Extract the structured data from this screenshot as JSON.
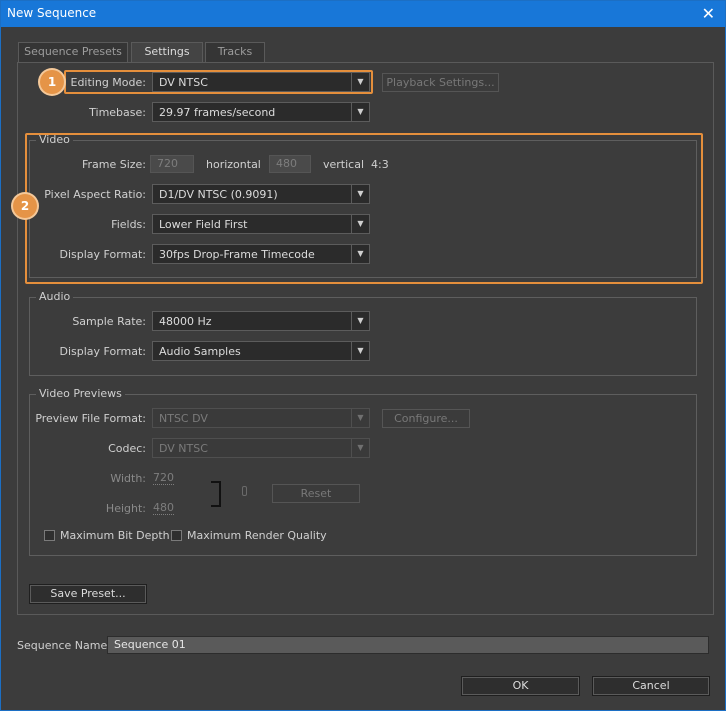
{
  "window": {
    "title": "New Sequence",
    "close_glyph": "✕"
  },
  "tabs": [
    {
      "label": "Sequence Presets"
    },
    {
      "label": "Settings"
    },
    {
      "label": "Tracks"
    }
  ],
  "settings": {
    "editing_mode": {
      "label": "Editing Mode:",
      "value": "DV NTSC"
    },
    "playback_settings": "Playback Settings...",
    "timebase": {
      "label": "Timebase:",
      "value": "29.97 frames/second"
    }
  },
  "video": {
    "title": "Video",
    "frame_size": {
      "label": "Frame Size:",
      "width": "720",
      "horizontal": "horizontal",
      "height": "480",
      "vertical": "vertical",
      "ratio": "4:3"
    },
    "pixel_aspect_ratio": {
      "label": "Pixel Aspect Ratio:",
      "value": "D1/DV NTSC (0.9091)"
    },
    "fields": {
      "label": "Fields:",
      "value": "Lower Field First"
    },
    "display_format": {
      "label": "Display Format:",
      "value": "30fps Drop-Frame Timecode"
    }
  },
  "audio": {
    "title": "Audio",
    "sample_rate": {
      "label": "Sample Rate:",
      "value": "48000 Hz"
    },
    "display_format": {
      "label": "Display Format:",
      "value": "Audio Samples"
    }
  },
  "video_previews": {
    "title": "Video Previews",
    "preview_file_format": {
      "label": "Preview File Format:",
      "value": "NTSC DV"
    },
    "configure": "Configure...",
    "codec": {
      "label": "Codec:",
      "value": "DV NTSC"
    },
    "width": {
      "label": "Width:",
      "value": "720"
    },
    "height": {
      "label": "Height:",
      "value": "480"
    },
    "reset": "Reset",
    "max_bit_depth": "Maximum Bit Depth",
    "max_render_quality": "Maximum Render Quality"
  },
  "save_preset": "Save Preset...",
  "sequence_name": {
    "label": "Sequence Name:",
    "value": "Sequence 01"
  },
  "ok": "OK",
  "cancel": "Cancel",
  "annotations": {
    "badge1": "1",
    "badge2": "2"
  },
  "colors": {
    "accent_orange": "#e58f3c",
    "titlebar_blue": "#1877d8"
  }
}
